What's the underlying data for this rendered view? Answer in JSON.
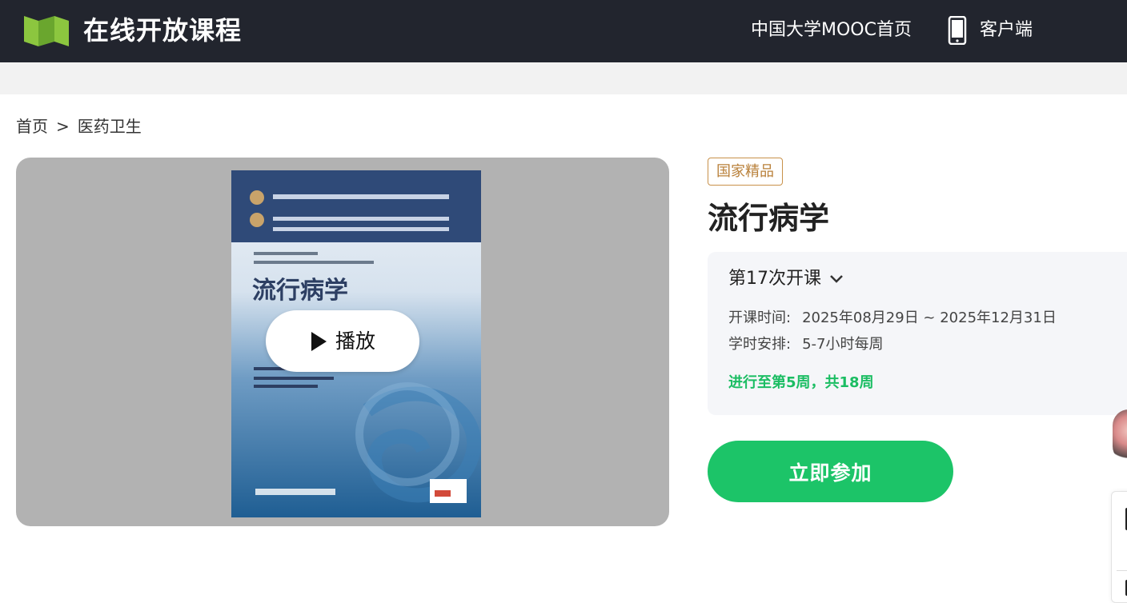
{
  "header": {
    "brand": "在线开放课程",
    "nav_home": "中国大学MOOC首页",
    "nav_client": "客户端",
    "logo_color": "#7ab83a",
    "background": "#22252e"
  },
  "breadcrumb": {
    "items": [
      "首页",
      "医药卫生"
    ],
    "separator": ">"
  },
  "player": {
    "play_label": "播放",
    "cover_title": "流行病学"
  },
  "course": {
    "badge": "国家精品",
    "title": "流行病学",
    "term": {
      "selected": "第17次开课",
      "time_label": "开课时间:",
      "time_value": "2025年08月29日 ~ 2025年12月31日",
      "hours_label": "学时安排:",
      "hours_value": "5-7小时每周",
      "progress": "进行至第5周，共18周"
    },
    "join_label": "立即参加"
  },
  "colors": {
    "accent_green": "#1cc468",
    "badge_gold": "#b9803a"
  }
}
